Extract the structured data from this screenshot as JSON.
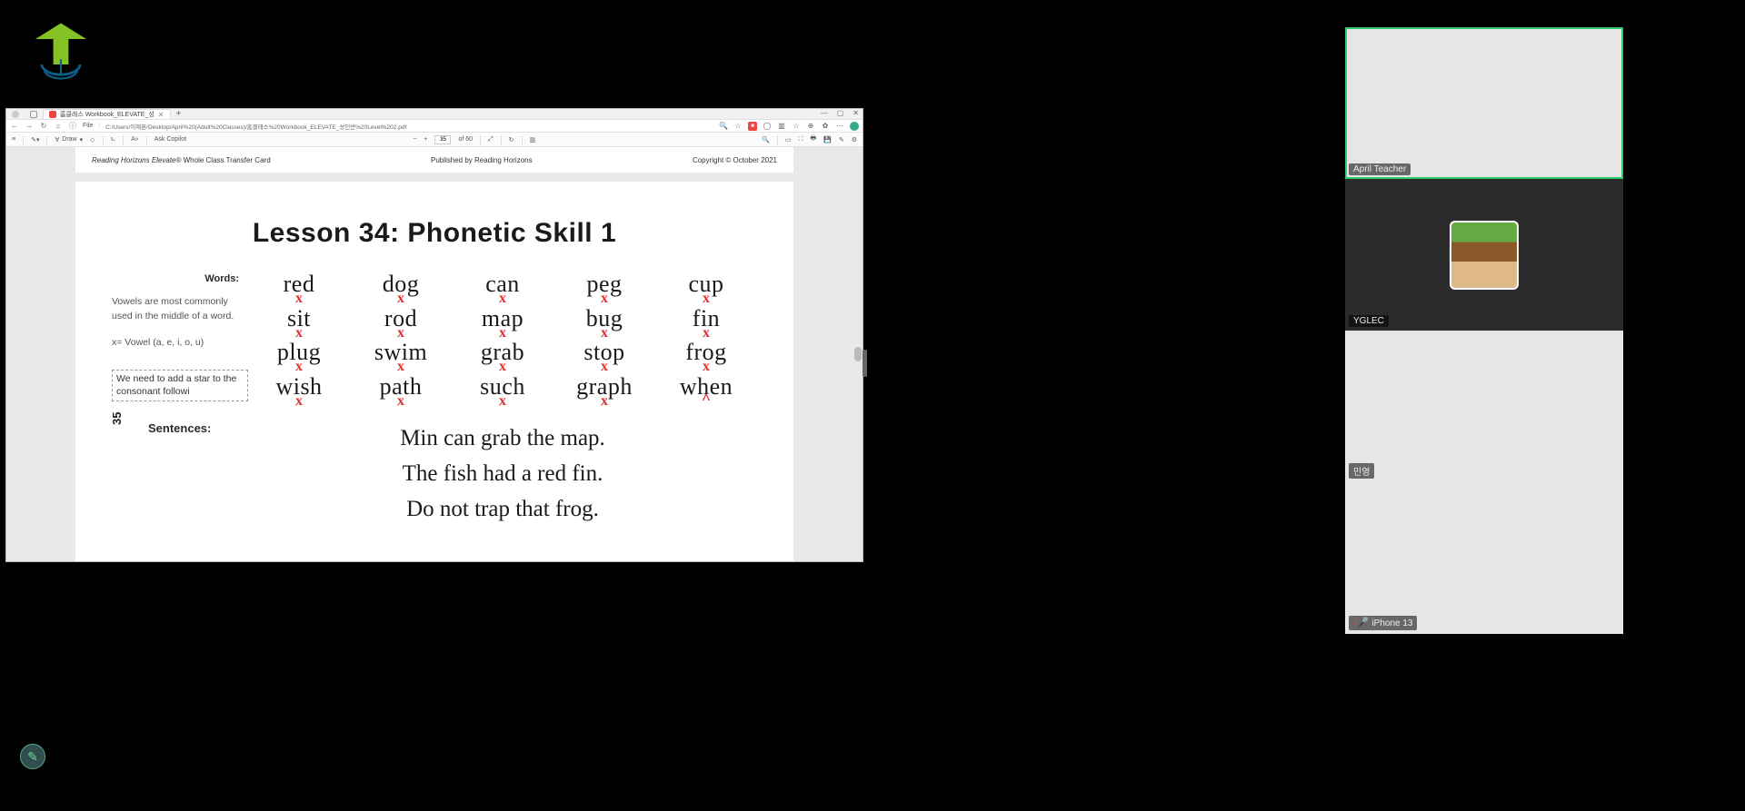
{
  "logo": {
    "name": "company-logo"
  },
  "browser": {
    "tab_title": "홈클래스 Workbook_ELEVATE_성",
    "url_label": "File",
    "url_path": "C:/Users/이재훈/Desktop/April%20(Adult%20Classes)/홈클래스%20Workbook_ELEVATE_성인반%20Level%202.pdf",
    "win": {
      "min": "—",
      "max": "▢",
      "close": "✕"
    }
  },
  "pdfbar": {
    "draw": "Draw",
    "copilot": "Ask Copilot",
    "minus": "−",
    "plus": "+",
    "page_current": "35",
    "page_total": "of 60"
  },
  "doc": {
    "header_left_italic": "Reading Horizons Elevate®",
    "header_left_rest": " Whole Class Transfer Card",
    "header_center": "Published by Reading Horizons",
    "header_right": "Copyright © October 2021",
    "title": "Lesson 34: Phonetic Skill 1",
    "words_label": "Words:",
    "note_text": "Vowels are most commonly used in the middle of a word.",
    "x_note": "x= Vowel (a, e, i, o, u)",
    "annotation": "We need to add a star to the consonant followi",
    "page_number": "35",
    "sentences_label": "Sentences:",
    "words_grid": [
      [
        "red",
        "dog",
        "can",
        "peg",
        "cup"
      ],
      [
        "sit",
        "rod",
        "map",
        "bug",
        "fin"
      ],
      [
        "plug",
        "swim",
        "grab",
        "stop",
        "frog"
      ],
      [
        "wish",
        "path",
        "such",
        "graph",
        "when"
      ]
    ],
    "mark_rows": [
      "x",
      "x",
      "x",
      "x"
    ],
    "caret_word": "when",
    "sentences": [
      "Min can grab the map.",
      "The fish had a red fin.",
      "Do not trap that frog."
    ]
  },
  "participants": [
    {
      "name": "April Teacher",
      "light": true,
      "speaking": true,
      "muted": false,
      "avatar": false
    },
    {
      "name": "YGLEC",
      "light": false,
      "speaking": false,
      "muted": false,
      "avatar": true
    },
    {
      "name": "민영",
      "light": true,
      "speaking": false,
      "muted": false,
      "avatar": false
    },
    {
      "name": "iPhone 13",
      "light": true,
      "speaking": false,
      "muted": true,
      "avatar": false
    }
  ]
}
